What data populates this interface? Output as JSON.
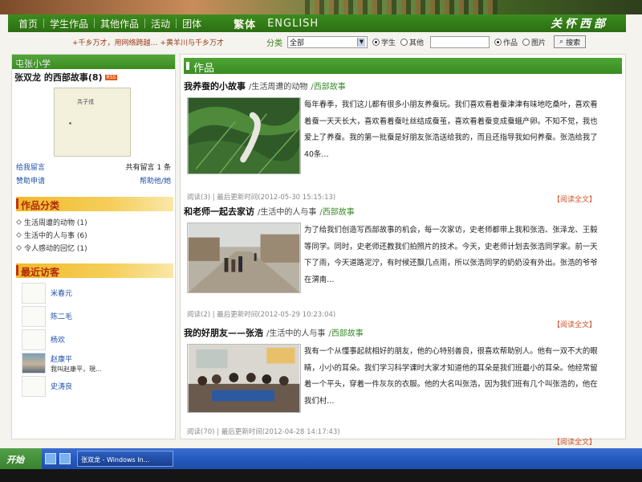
{
  "nav": {
    "items": [
      "首页",
      "学生作品",
      "其他作品",
      "活动",
      "团体"
    ],
    "lang_trad": "繁体",
    "lang_en": "ENGLISH",
    "logo": "关怀西部"
  },
  "search": {
    "marquee": "+千乡万才，用网络跨越…  +黄羊川与千乡万才",
    "label": "分类",
    "select_value": "全部",
    "radio1": "学生",
    "radio2": "其他",
    "radio3": "作品",
    "radio4": "图片",
    "button": "搜索"
  },
  "sidebar": {
    "school": "屯张小学",
    "author": "张双龙  的西部故事(8)",
    "rss": "RSS",
    "map_label": "共子戎",
    "leave_msg": "给我留言",
    "msg_count": "共有留言 1 条",
    "sponsor": "赞助申请",
    "help": "帮助他/她",
    "categories_title": "作品分类",
    "categories": [
      "生活周遭的动物 (1)",
      "生活中的人与事 (6)",
      "令人感动的回忆 (1)"
    ],
    "visitors_title": "最近访客",
    "visitors": [
      "米春元",
      "陈二毛",
      "杨欢",
      "赵康平",
      "史涛良"
    ],
    "visitor_note": "我叫赵康平，現…"
  },
  "main": {
    "section_title": "作品",
    "articles": [
      {
        "title": "我养蚕的小故事",
        "category": "/生活周遭的动物",
        "series": "/西部故事",
        "text": "每年春季，我们这儿都有很多小朋友养蚕玩。我们喜欢看着蚕津津有味地吃桑叶，喜欢看着蚕一天天长大，喜欢看着蚕吐丝结成蚕茧，喜欢看着蚕变成蚕蛾产卵。不知不觉，我也爱上了养蚕。我的第一批蚕是好朋友张浩送给我的，而且还指导我如何养蚕。张浩给我了40条…",
        "meta": "阅读(3)  |  最后更新时间(2012-05-30 15:15:13)",
        "read_more": "【阅读全文】"
      },
      {
        "title": "和老师一起去家访",
        "category": "/生活中的人与事",
        "series": "/西部故事",
        "text": "为了给我们创造写西部故事的机会，每一次家访，史老师都带上我和张浩、张泽龙、王毅等同学。同时，史老师还教我们拍照片的技术。今天，史老师计划去张浩同学家。前一天下了雨，今天道路泥泞，有时候还飘几点雨，所以张浩同学的奶奶没有外出。张浩的爷爷在渭南…",
        "meta": "阅读(2)  |  最后更新时间(2012-05-29 10:23:04)",
        "read_more": "【阅读全文】"
      },
      {
        "title": "我的好朋友——张浩",
        "category": "/生活中的人与事",
        "series": "/西部故事",
        "text": "我有一个从懂事起就相好的朋友，他的心特别善良，很喜欢帮助别人。他有一双不大的眼睛，小小的耳朵。我们学习科学课时大家才知道他的耳朵是我们班最小的耳朵。他经常留着一个平头，穿着一件灰灰的衣服。他的大名叫张浩，因为我们班有几个叫张浩的，他在我们村…",
        "meta": "阅读(70)  |  最后更新时间(2012-04-28 14:17:43)",
        "read_more": "【阅读全文】"
      }
    ]
  },
  "taskbar": {
    "start": "开始",
    "task": "张双龙 - Windows In..."
  }
}
